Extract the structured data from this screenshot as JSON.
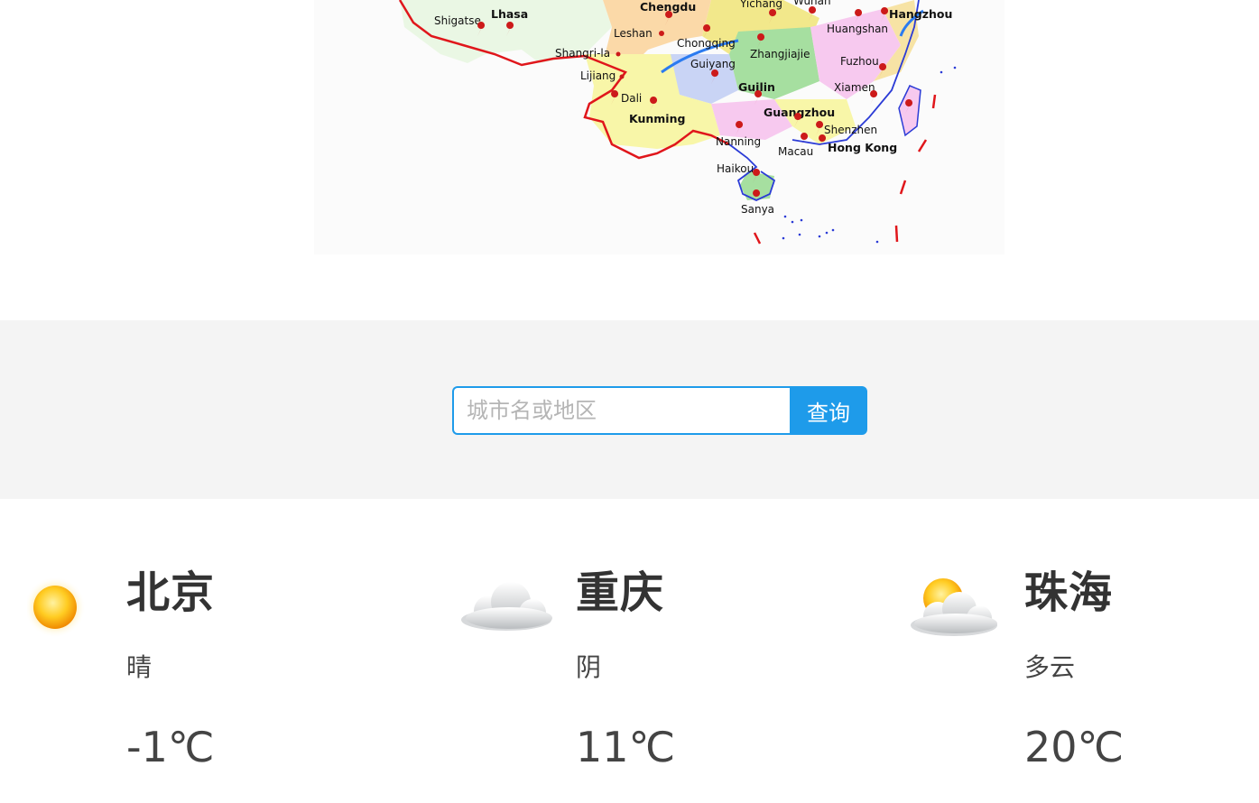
{
  "map": {
    "cities": [
      {
        "name": "Shigatse",
        "bold": false
      },
      {
        "name": "Lhasa",
        "bold": true
      },
      {
        "name": "Chengdu",
        "bold": true
      },
      {
        "name": "Yichang",
        "bold": false
      },
      {
        "name": "Wuhan",
        "bold": false
      },
      {
        "name": "Hangzhou",
        "bold": true
      },
      {
        "name": "Leshan",
        "bold": false
      },
      {
        "name": "Huangshan",
        "bold": false
      },
      {
        "name": "Chongqing",
        "bold": false
      },
      {
        "name": "Shangri-la",
        "bold": false
      },
      {
        "name": "Zhangjiajie",
        "bold": false
      },
      {
        "name": "Guiyang",
        "bold": false
      },
      {
        "name": "Fuzhou",
        "bold": false
      },
      {
        "name": "Lijiang",
        "bold": false
      },
      {
        "name": "Guilin",
        "bold": true
      },
      {
        "name": "Xiamen",
        "bold": false
      },
      {
        "name": "Dali",
        "bold": false
      },
      {
        "name": "Kunming",
        "bold": true
      },
      {
        "name": "Guangzhou",
        "bold": true
      },
      {
        "name": "Shenzhen",
        "bold": false
      },
      {
        "name": "Nanning",
        "bold": false
      },
      {
        "name": "Macau",
        "bold": false
      },
      {
        "name": "Hong Kong",
        "bold": true
      },
      {
        "name": "Haikou",
        "bold": false
      },
      {
        "name": "Sanya",
        "bold": false
      }
    ]
  },
  "search": {
    "placeholder": "城市名或地区",
    "button_label": "查询",
    "accent_color": "#1e9bea"
  },
  "weather": [
    {
      "city": "北京",
      "condition": "晴",
      "temperature": "-1℃",
      "icon": "sunny-icon"
    },
    {
      "city": "重庆",
      "condition": "阴",
      "temperature": "11℃",
      "icon": "overcast-cloud-icon"
    },
    {
      "city": "珠海",
      "condition": "多云",
      "temperature": "20℃",
      "icon": "partly-cloudy-icon"
    }
  ]
}
